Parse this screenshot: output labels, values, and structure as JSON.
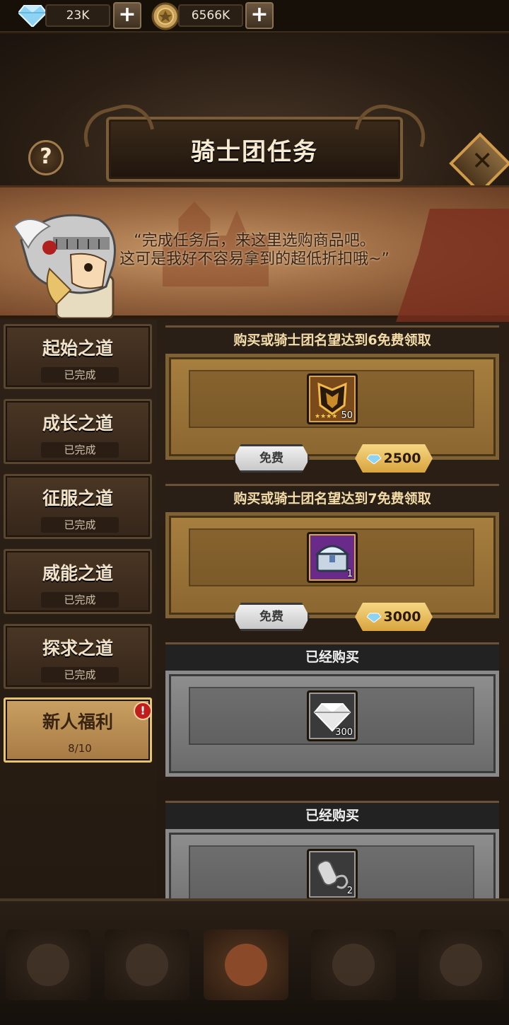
{
  "currency": {
    "gems": "23K",
    "coins": "6566K"
  },
  "header": {
    "title": "骑士团任务",
    "help_label": "?",
    "close_label": "✕"
  },
  "speech": {
    "line1": "“完成任务后，来这里选购商品吧。",
    "line2": "这可是我好不容易拿到的超低折扣哦~”"
  },
  "nav": [
    {
      "label": "起始之道",
      "status": "已完成"
    },
    {
      "label": "成长之道",
      "status": "已完成"
    },
    {
      "label": "征服之道",
      "status": "已完成"
    },
    {
      "label": "威能之道",
      "status": "已完成"
    },
    {
      "label": "探求之道",
      "status": "已完成"
    },
    {
      "label": "新人福利",
      "status": "8/10",
      "badge": "!"
    }
  ],
  "offers": [
    {
      "header": "购买或骑士团名望达到6免费领取",
      "item_icon": "crest-icon",
      "count": "50",
      "free_label": "免费",
      "price": "2500",
      "color": "#7a4a1a"
    },
    {
      "header": "购买或骑士团名望达到7免费领取",
      "item_icon": "chest-icon",
      "count": "1",
      "free_label": "免费",
      "price": "3000",
      "color": "#6a2a8a"
    },
    {
      "header": "已经购买",
      "item_icon": "diamond-icon",
      "count": "300"
    },
    {
      "header": "已经购买",
      "item_icon": "scroll-icon",
      "count": "2"
    }
  ]
}
